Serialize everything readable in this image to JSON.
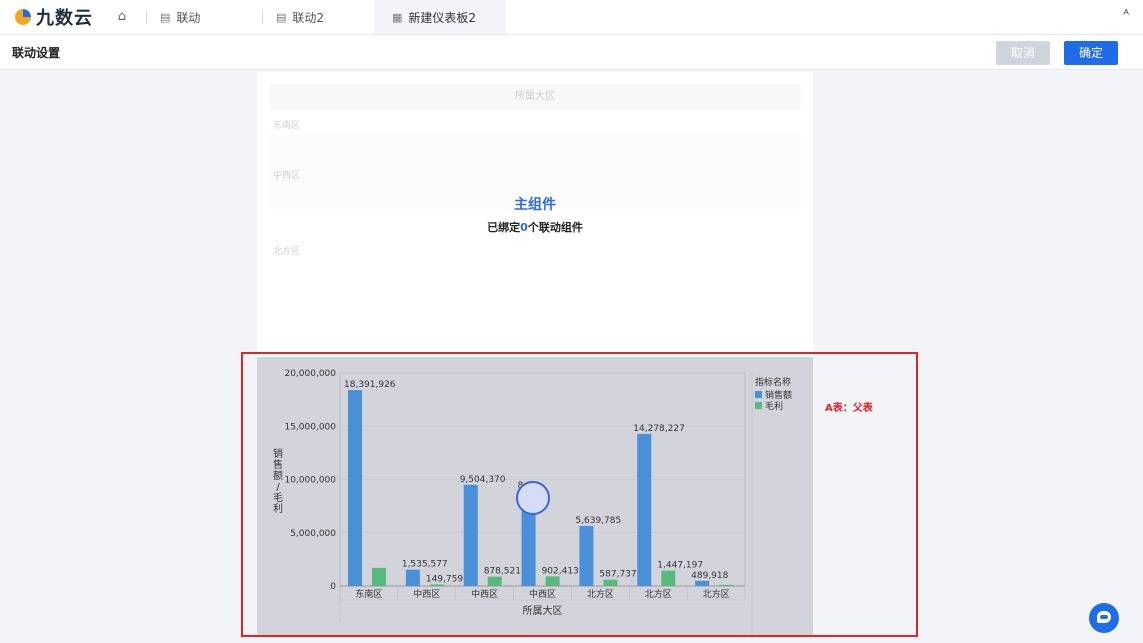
{
  "app": {
    "logo_text": "九数云"
  },
  "tabs": [
    {
      "label": "联动"
    },
    {
      "label": "联动2"
    },
    {
      "label": "新建仪表板2"
    }
  ],
  "subbar": {
    "title": "联动设置",
    "cancel_label": "取消",
    "ok_label": "确定"
  },
  "main_component": {
    "table_header": "所属大区",
    "regions": [
      "东南区",
      "中西区",
      "北方区"
    ],
    "title": "主组件",
    "bound_prefix": "已绑定",
    "bound_count": "0",
    "bound_suffix": "个联动组件"
  },
  "annotation": "A表：父表",
  "colors": {
    "accent": "#1e6ce8",
    "sales": "#4a90d9",
    "profit": "#58b97c",
    "highlight": "#e0242a"
  },
  "chart_data": {
    "type": "bar",
    "categories": [
      "东南区",
      "中西区",
      "中西区",
      "中西区",
      "北方区",
      "北方区",
      "北方区"
    ],
    "series": [
      {
        "name": "销售额",
        "values": [
          18391926,
          1535577,
          9504370,
          8900000,
          5639785,
          14278227,
          489918
        ],
        "labels": [
          "18,391,926",
          "1,535,577",
          "9,504,370",
          "8,9",
          "5,639,785",
          "14,278,227",
          "489,918"
        ]
      },
      {
        "name": "毛利",
        "values": [
          1700000,
          149759,
          878521,
          902413,
          587737,
          1447197,
          100000
        ],
        "labels": [
          "",
          "149,759",
          "878,521",
          "902,413",
          "587,737",
          "1,447,197",
          ""
        ]
      }
    ],
    "xlabel": "所属大区",
    "ylabel": "销售额/毛利",
    "yticks": [
      "0",
      "5,000,000",
      "10,000,000",
      "15,000,000",
      "20,000,000"
    ],
    "ylim": [
      0,
      20000000
    ],
    "legend_title": "指标名称",
    "legend_position": "top-right"
  }
}
